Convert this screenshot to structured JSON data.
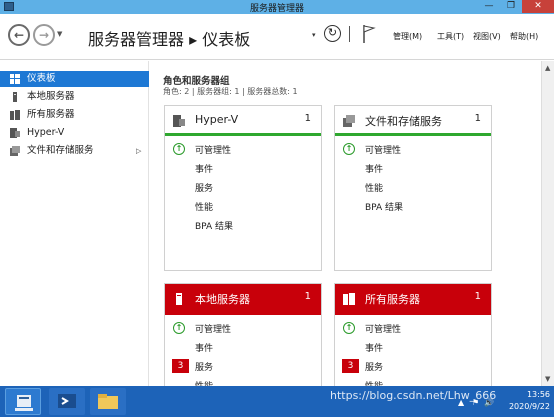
{
  "window": {
    "title": "服务器管理器",
    "min": "—",
    "max": "❐",
    "close": "✕"
  },
  "header": {
    "back": "←",
    "forward": "→",
    "nav_dropdown": "▼",
    "breadcrumb": "服务器管理器 ▸ 仪表板",
    "refresh": "↻",
    "refresh_dropdown": "▾",
    "menu": {
      "manage": "管理(M)",
      "tools": "工具(T)",
      "view": "视图(V)",
      "help": "帮助(H)"
    }
  },
  "sidebar": {
    "items": [
      {
        "label": "仪表板",
        "icon": "dashboard-icon",
        "active": true
      },
      {
        "label": "本地服务器",
        "icon": "server-icon"
      },
      {
        "label": "所有服务器",
        "icon": "servers-icon"
      },
      {
        "label": "Hyper-V",
        "icon": "hyperv-icon"
      },
      {
        "label": "文件和存储服务",
        "icon": "storage-icon",
        "chevron": "▷"
      }
    ]
  },
  "main": {
    "section_title": "角色和服务器组",
    "section_sub": "角色: 2 | 服务器组: 1 | 服务器总数: 1",
    "scroll_up": "▲",
    "scroll_down": "▼",
    "tiles": [
      {
        "name": "Hyper-V",
        "count": "1",
        "status": "ok",
        "rows": [
          "可管理性",
          "事件",
          "服务",
          "性能",
          "BPA 结果"
        ]
      },
      {
        "name": "文件和存储服务",
        "count": "1",
        "status": "ok",
        "rows": [
          "可管理性",
          "事件",
          "性能",
          "BPA 结果"
        ]
      },
      {
        "name": "本地服务器",
        "count": "1",
        "status": "alert",
        "rows": [
          "可管理性",
          "事件",
          "服务",
          "性能"
        ],
        "service_badge": "3"
      },
      {
        "name": "所有服务器",
        "count": "1",
        "status": "alert",
        "rows": [
          "可管理性",
          "事件",
          "服务",
          "性能"
        ],
        "service_badge": "3"
      }
    ]
  },
  "taskbar": {
    "time": "13:56",
    "date": "2020/9/22",
    "tray": [
      "▲",
      "⚑",
      "🔊"
    ],
    "watermark": "https://blog.csdn.net/Lhw_666"
  },
  "colors": {
    "accent": "#1e78d4",
    "ok": "#2fa82f",
    "alert": "#c8000a",
    "taskbar": "#1d63b8",
    "titlebar": "#5eb0e6"
  }
}
